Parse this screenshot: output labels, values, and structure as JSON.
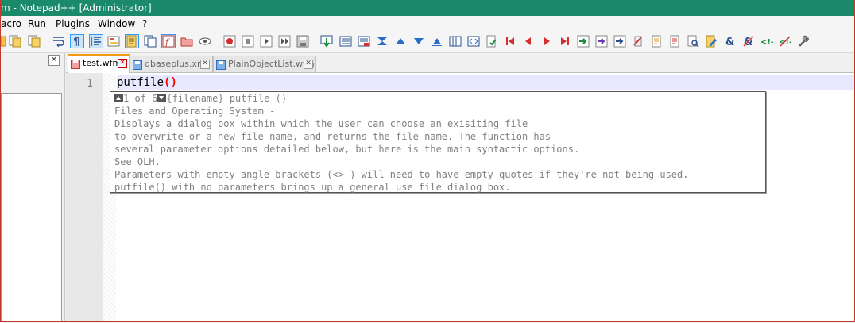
{
  "window": {
    "title": "m - Notepad++ [Administrator]"
  },
  "menu": {
    "items": [
      "acro",
      "Run",
      "Plugins",
      "Window",
      "?"
    ]
  },
  "left_panel": {
    "close_glyph": "✕"
  },
  "tabs": [
    {
      "label": "test.wfm",
      "active": true
    },
    {
      "label": "dbaseplus.xml",
      "active": false
    },
    {
      "label": "PlainObjectList.wfm",
      "active": false
    }
  ],
  "editor": {
    "line_number": "1",
    "code_text": "putfile",
    "code_parens": "()"
  },
  "calltip": {
    "counter": "1 of 6",
    "signature": "{filename} putfile ()",
    "lines": [
      "Files and Operating System -",
      "Displays a dialog box within which the user can choose an exisiting file",
      "to overwrite or a new file name, and returns the file name. The function has",
      "several parameter options detailed below, but here is the main syntactic options.",
      "See OLH.",
      "Parameters with empty angle brackets (<> ) will need to have empty quotes if they're not being used.",
      "putfile() with no parameters brings up a general use file dialog box."
    ]
  },
  "colors": {
    "titlebar": "#1b8a6b",
    "active_tab_accent": "#f39c12",
    "current_line": "#e8e8ff",
    "brace_highlight": "#ff0000"
  }
}
